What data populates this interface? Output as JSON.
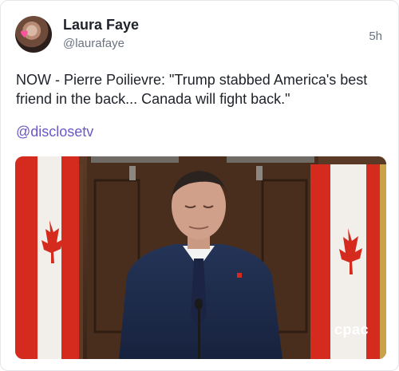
{
  "post": {
    "author_name": "Laura Faye",
    "author_handle": "@laurafaye",
    "timestamp": "5h",
    "text": "NOW - Pierre Poilievre: \"Trump stabbed America's best friend in the back... Canada will fight back.\"",
    "mention": "@disclosetv"
  },
  "media": {
    "broadcaster_logo": "cpac",
    "colors": {
      "flag_red": "#d52b1e",
      "wood": "#4b2f1f",
      "suit": "#1f2c4d",
      "mention": "#6c57c9"
    }
  }
}
